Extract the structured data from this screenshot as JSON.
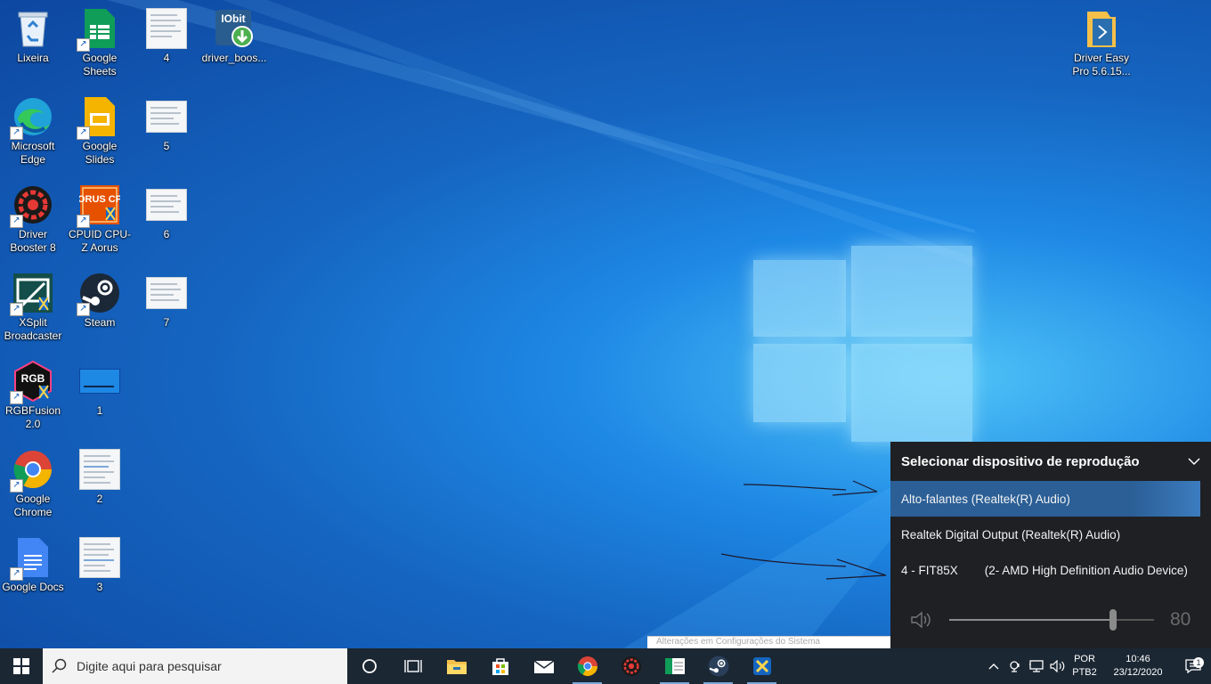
{
  "desktop": {
    "icons": [
      {
        "label": "Lixeira"
      },
      {
        "label": "Google Sheets"
      },
      {
        "label": "4"
      },
      {
        "label": "driver_boos..."
      },
      {
        "label": "Microsoft Edge"
      },
      {
        "label": "Google Slides"
      },
      {
        "label": "5"
      },
      {
        "label": "Driver Booster 8"
      },
      {
        "label": "CPUID CPU-Z Aorus"
      },
      {
        "label": "6"
      },
      {
        "label": "XSplit Broadcaster"
      },
      {
        "label": "Steam"
      },
      {
        "label": "7"
      },
      {
        "label": "RGBFusion 2.0"
      },
      {
        "label": "1"
      },
      {
        "label": "Google Chrome"
      },
      {
        "label": "2"
      },
      {
        "label": "Google Docs"
      },
      {
        "label": "3"
      },
      {
        "label": "Driver Easy Pro 5.6.15..."
      }
    ],
    "icon_glyphs": {
      "aorus": "AORUS CPU",
      "rgb": "RGB",
      "iobit": "IObit"
    }
  },
  "audio_flyout": {
    "title": "Selecionar dispositivo de reprodução",
    "devices": [
      {
        "name": "Alto-falantes (Realtek(R) Audio)",
        "selected": true
      },
      {
        "name": "Realtek Digital Output (Realtek(R) Audio)",
        "selected": false
      },
      {
        "name": "4 - FIT85X",
        "detail": "(2- AMD High Definition Audio Device)",
        "selected": false
      }
    ],
    "volume": 80,
    "volume_label": "80"
  },
  "behind_window_text": "Alterações em Configurações do Sistema",
  "taskbar": {
    "search_placeholder": "Digite aqui para pesquisar",
    "apps": [
      "cortana-icon",
      "task-view-icon",
      "file-explorer-icon",
      "store-icon",
      "mail-icon",
      "chrome-icon",
      "driver-booster-icon",
      "sheets-icon",
      "steam-icon",
      "xsplit-x-icon"
    ],
    "tray": {
      "lang_top": "POR",
      "lang_bottom": "PTB2",
      "time": "10:46",
      "date": "23/12/2020",
      "notification_count": "1"
    }
  },
  "colors": {
    "flyout_bg": "#1f2024",
    "selected_row": "#2b5f96",
    "taskbar_bg": "#1b2733"
  }
}
